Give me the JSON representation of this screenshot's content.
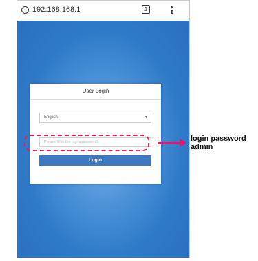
{
  "browser": {
    "url": "192.168.168.1",
    "tab_count": "1",
    "info_icon": "info-icon",
    "menu_icon": "kebab-menu-icon"
  },
  "login": {
    "title": "User Login",
    "language": "English",
    "password_placeholder": "Please fill in the login password!",
    "button": "Login"
  },
  "annotation": {
    "line1": "login password",
    "line2": "admin"
  },
  "colors": {
    "background_blue": "#2f7ac8",
    "button_blue": "#3d78c2",
    "highlight": "#e2214e",
    "arrow": "#e2186f"
  }
}
